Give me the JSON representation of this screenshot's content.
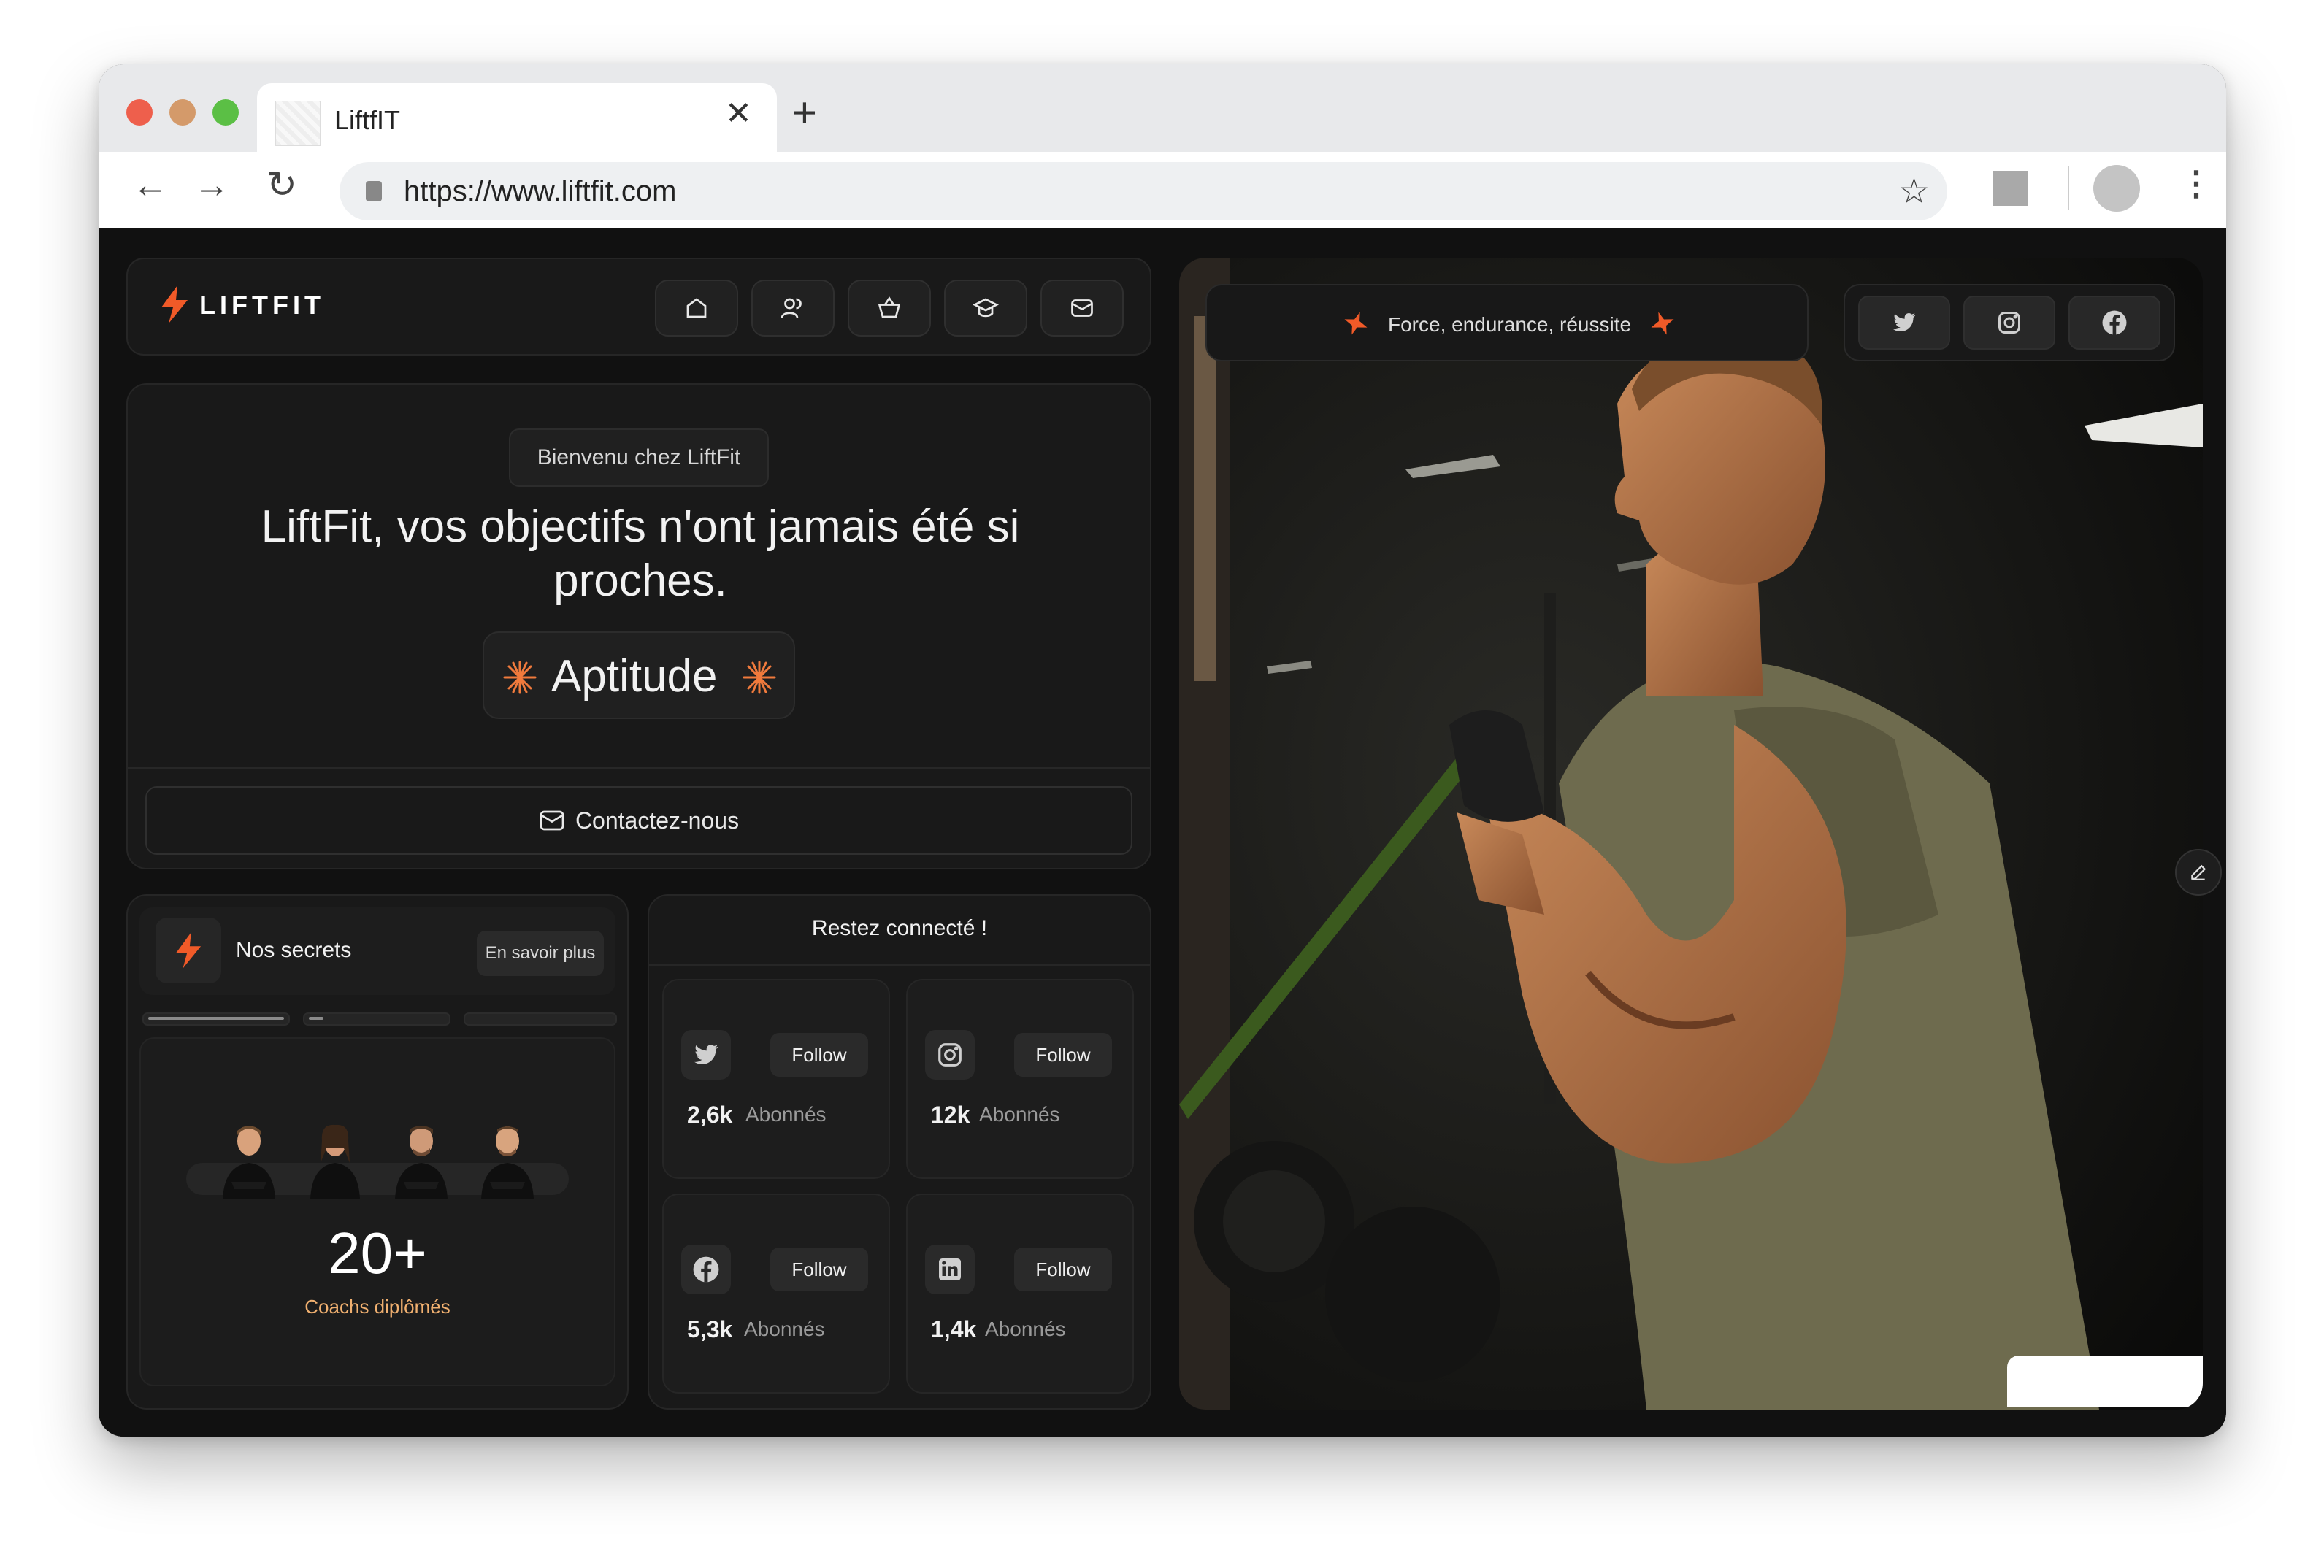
{
  "browser": {
    "tab_title": "LiftfIT",
    "url": "https://www.liftfit.com",
    "traffic_lights": [
      "#ee5f4c",
      "#d49a6a",
      "#5bbf45"
    ]
  },
  "brand": {
    "logo_text": "LIFTFIT",
    "accent": "#f05a28"
  },
  "nav": {
    "icons": [
      "home-icon",
      "users-icon",
      "basket-icon",
      "graduation-cap-icon",
      "mail-icon"
    ]
  },
  "hero": {
    "badge": "Bienvenu chez LiftFit",
    "title": "LiftFit, vos objectifs n'ont jamais été si proches.",
    "keyword": "Aptitude",
    "contact_button": "Contactez-nous"
  },
  "secrets": {
    "label": "Nos secrets",
    "more_button": "En savoir plus",
    "progress": [
      1.0,
      0.1,
      0.0
    ],
    "stat_value": "20+",
    "stat_label": "Coachs diplômés"
  },
  "social": {
    "title": "Restez connecté !",
    "follow_label": "Follow",
    "subscribers_label": "Abonnés",
    "cards": [
      {
        "network": "twitter-icon",
        "count": "2,6k"
      },
      {
        "network": "instagram-icon",
        "count": "12k"
      },
      {
        "network": "facebook-icon",
        "count": "5,3k"
      },
      {
        "network": "linkedin-icon",
        "count": "1,4k"
      }
    ]
  },
  "photo": {
    "tagline": "Force, endurance, réussite",
    "social_icons": [
      "twitter-icon",
      "instagram-icon",
      "facebook-icon"
    ]
  }
}
